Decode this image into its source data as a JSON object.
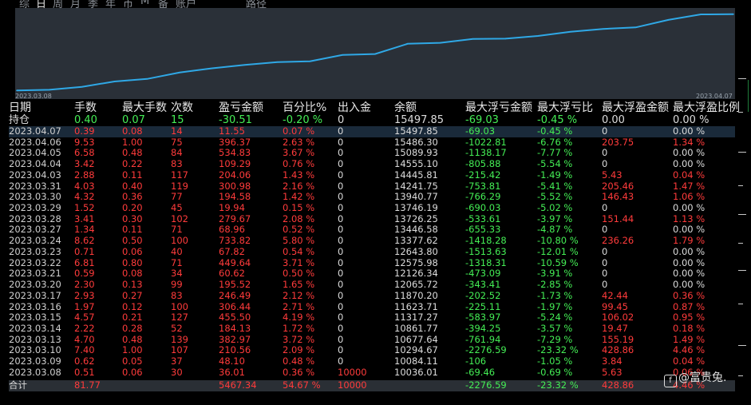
{
  "tabs": [
    {
      "label": "综"
    },
    {
      "label": "日",
      "active": true
    },
    {
      "label": "周"
    },
    {
      "label": "月"
    },
    {
      "label": "季"
    },
    {
      "label": "年"
    },
    {
      "label": "币"
    },
    {
      "label": "M"
    },
    {
      "label": "备"
    },
    {
      "label": "账户"
    },
    {
      "label": "路径"
    }
  ],
  "chart": {
    "x_start_label": "2023.03.08",
    "x_end_label": "2023.04.07",
    "line_color": "#2fa8e6"
  },
  "chart_data": {
    "type": "line",
    "x": [
      "2023.03.08",
      "2023.03.09",
      "2023.03.10",
      "2023.03.13",
      "2023.03.14",
      "2023.03.15",
      "2023.03.16",
      "2023.03.17",
      "2023.03.20",
      "2023.03.21",
      "2023.03.22",
      "2023.03.23",
      "2023.03.24",
      "2023.03.27",
      "2023.03.28",
      "2023.03.29",
      "2023.03.30",
      "2023.03.31",
      "2023.04.03",
      "2023.04.04",
      "2023.04.05",
      "2023.04.06",
      "2023.04.07"
    ],
    "series": [
      {
        "values": [
          10036.01,
          10084.11,
          10294.67,
          10677.64,
          10861.77,
          11317.27,
          11623.71,
          11870.2,
          12065.72,
          12126.34,
          12575.98,
          12643.8,
          13377.62,
          13446.58,
          13726.25,
          13746.19,
          13940.77,
          14241.75,
          14445.81,
          14555.1,
          15089.93,
          15486.3,
          15497.85
        ]
      }
    ],
    "xlabel": "",
    "ylabel": "",
    "grid": false
  },
  "table": {
    "headers": [
      "日期",
      "手数",
      "最大手数",
      "次数",
      "盈亏金额",
      "百分比%",
      "出入金",
      "余额",
      "最大浮亏金额",
      "最大浮亏比",
      "最大浮盈金额",
      "最大浮盈比例"
    ],
    "holding": {
      "label": "持仓",
      "cells": [
        "0.40",
        "0.07",
        "15",
        "-30.51",
        "-0.20 %",
        "0",
        "15497.85",
        "-69.03",
        "-0.45 %",
        "0.00",
        "0.00 %"
      ],
      "colors": [
        "green",
        "green",
        "green",
        "green",
        "green",
        "white",
        "white",
        "green",
        "green",
        "white",
        "white"
      ]
    },
    "rows": [
      {
        "cells": [
          "2023.04.07",
          "0.39",
          "0.08",
          "14",
          "11.55",
          "0.07 %",
          "0",
          "15497.85",
          "-69.03",
          "-0.45 %",
          "0",
          "0.00 %"
        ],
        "up": 0,
        "up_profit": false
      },
      {
        "cells": [
          "2023.04.06",
          "9.53",
          "1.00",
          "75",
          "396.37",
          "2.63 %",
          "0",
          "15486.30",
          "-1022.81",
          "-6.76 %",
          "203.75",
          "1.34 %"
        ],
        "up_profit": true
      },
      {
        "cells": [
          "2023.04.05",
          "6.58",
          "0.48",
          "84",
          "534.83",
          "3.67 %",
          "0",
          "15089.93",
          "-1138.17",
          "-7.77 %",
          "0",
          "0.00 %"
        ],
        "up_profit": false
      },
      {
        "cells": [
          "2023.04.04",
          "3.42",
          "0.22",
          "83",
          "109.29",
          "0.76 %",
          "0",
          "14555.10",
          "-805.88",
          "-5.54 %",
          "0",
          "0.00 %"
        ],
        "up_profit": false
      },
      {
        "cells": [
          "2023.04.03",
          "2.88",
          "0.11",
          "117",
          "204.06",
          "1.43 %",
          "0",
          "14445.81",
          "-215.42",
          "-1.49 %",
          "5.43",
          "0.04 %"
        ],
        "up_profit": true
      },
      {
        "cells": [
          "2023.03.31",
          "4.03",
          "0.40",
          "119",
          "300.98",
          "2.16 %",
          "0",
          "14241.75",
          "-753.81",
          "-5.41 %",
          "205.46",
          "1.47 %"
        ],
        "up_profit": true
      },
      {
        "cells": [
          "2023.03.30",
          "4.32",
          "0.36",
          "77",
          "194.58",
          "1.42 %",
          "0",
          "13940.77",
          "-766.29",
          "-5.52 %",
          "146.43",
          "1.06 %"
        ],
        "up_profit": true
      },
      {
        "cells": [
          "2023.03.29",
          "1.52",
          "0.20",
          "45",
          "19.94",
          "0.15 %",
          "0",
          "13746.19",
          "-690.03",
          "-5.02 %",
          "0",
          "0.00 %"
        ],
        "up_profit": false
      },
      {
        "cells": [
          "2023.03.28",
          "3.41",
          "0.30",
          "102",
          "279.67",
          "2.08 %",
          "0",
          "13726.25",
          "-533.61",
          "-3.97 %",
          "151.44",
          "1.13 %"
        ],
        "up_profit": true
      },
      {
        "cells": [
          "2023.03.27",
          "1.34",
          "0.11",
          "71",
          "68.96",
          "0.52 %",
          "0",
          "13446.58",
          "-655.33",
          "-4.87 %",
          "0",
          "0.00 %"
        ],
        "up_profit": false
      },
      {
        "cells": [
          "2023.03.24",
          "8.62",
          "0.50",
          "100",
          "733.82",
          "5.80 %",
          "0",
          "13377.62",
          "-1418.28",
          "-10.80 %",
          "236.26",
          "1.79 %"
        ],
        "up_profit": true
      },
      {
        "cells": [
          "2023.03.23",
          "0.71",
          "0.06",
          "40",
          "67.82",
          "0.54 %",
          "0",
          "12643.80",
          "-1513.63",
          "-12.01 %",
          "0",
          "0.00 %"
        ],
        "up_profit": false
      },
      {
        "cells": [
          "2023.03.22",
          "6.81",
          "0.80",
          "71",
          "449.64",
          "3.71 %",
          "0",
          "12575.98",
          "-1318.31",
          "-10.59 %",
          "0",
          "0.00 %"
        ],
        "up_profit": false
      },
      {
        "cells": [
          "2023.03.21",
          "0.59",
          "0.08",
          "34",
          "60.62",
          "0.50 %",
          "0",
          "12126.34",
          "-473.09",
          "-3.91 %",
          "0",
          "0.00 %"
        ],
        "up_profit": false
      },
      {
        "cells": [
          "2023.03.20",
          "2.30",
          "0.13",
          "99",
          "195.52",
          "1.65 %",
          "0",
          "12065.72",
          "-343.41",
          "-2.85 %",
          "0",
          "0.00 %"
        ],
        "up_profit": false
      },
      {
        "cells": [
          "2023.03.17",
          "2.93",
          "0.27",
          "83",
          "246.49",
          "2.12 %",
          "0",
          "11870.20",
          "-202.52",
          "-1.73 %",
          "42.44",
          "0.36 %"
        ],
        "up_profit": true
      },
      {
        "cells": [
          "2023.03.16",
          "1.97",
          "0.12",
          "100",
          "306.44",
          "2.71 %",
          "0",
          "11623.71",
          "-225.11",
          "-1.97 %",
          "99.45",
          "0.87 %"
        ],
        "up_profit": true
      },
      {
        "cells": [
          "2023.03.15",
          "4.57",
          "0.21",
          "127",
          "455.50",
          "4.19 %",
          "0",
          "11317.27",
          "-583.97",
          "-5.24 %",
          "106.02",
          "0.95 %"
        ],
        "up_profit": true
      },
      {
        "cells": [
          "2023.03.14",
          "2.22",
          "0.28",
          "52",
          "184.13",
          "1.72 %",
          "0",
          "10861.77",
          "-394.25",
          "-3.57 %",
          "19.47",
          "0.18 %"
        ],
        "up_profit": true
      },
      {
        "cells": [
          "2023.03.13",
          "4.70",
          "0.48",
          "139",
          "382.97",
          "3.72 %",
          "0",
          "10677.64",
          "-761.94",
          "-7.29 %",
          "155.19",
          "1.49 %"
        ],
        "up_profit": true
      },
      {
        "cells": [
          "2023.03.10",
          "7.40",
          "1.00",
          "107",
          "210.56",
          "2.09 %",
          "0",
          "10294.67",
          "-2276.59",
          "-23.32 %",
          "428.86",
          "4.46 %"
        ],
        "up_profit": true
      },
      {
        "cells": [
          "2023.03.09",
          "0.62",
          "0.05",
          "37",
          "48.10",
          "0.48 %",
          "0",
          "10084.11",
          "-106",
          "-1.05 %",
          "3.84",
          "0.04 %"
        ],
        "up_profit": true
      },
      {
        "cells": [
          "2023.03.08",
          "0.51",
          "0.06",
          "30",
          "36.01",
          "0.36 %",
          "10000",
          "10036.01",
          "-69.46",
          "-0.69 %",
          "5.63",
          "0.06 %"
        ],
        "up_profit": true,
        "deposit": true
      }
    ],
    "total": {
      "label": "合计",
      "cells": [
        "81.77",
        "",
        "",
        "5467.34",
        "54.67 %",
        "10000",
        "",
        "-2276.59",
        "-23.32 %",
        "428.86",
        "4.46 %"
      ],
      "colors": [
        "red",
        "red",
        "red",
        "red",
        "red",
        "red",
        "white",
        "green",
        "green",
        "red",
        "red"
      ]
    }
  },
  "watermark": {
    "icon": "facebook-icon",
    "text": "@富贵兔."
  },
  "colors": {
    "red": "#ff3b3b",
    "green": "#44ee55",
    "chart_bg": "#2a3038",
    "line": "#2fa8e6"
  }
}
